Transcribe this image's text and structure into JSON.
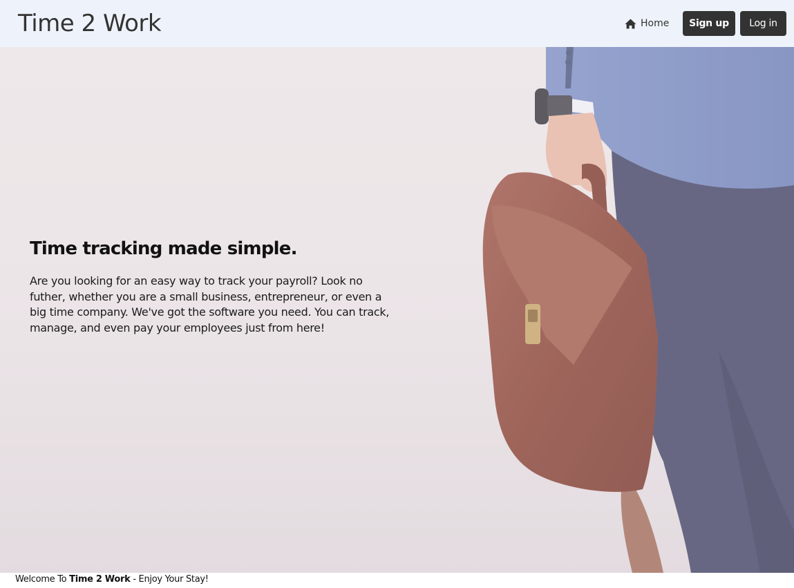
{
  "header": {
    "brand": "Time 2 Work",
    "nav": {
      "home_icon": "home-icon",
      "home_label": "Home",
      "signup_label": "Sign up",
      "login_label": "Log in"
    }
  },
  "hero": {
    "background": "photo of a person in a blue suit jacket carrying a brown leather briefcase",
    "heading": "Time tracking made simple.",
    "body": "Are you looking for an easy way to track your payroll? Look no futher, whether you are a small business, entrepreneur, or even a big time company. We've got the software you need. You can track, manage, and even pay your employees just from here!"
  },
  "footer": {
    "prefix": "Welcome To ",
    "brand": "Time 2 Work",
    "suffix": " - Enjoy Your Stay!"
  },
  "colors": {
    "header_bg": "#eef3fb",
    "button_bg": "#333333",
    "button_text": "#ffffff",
    "jacket": "#8093c6",
    "pants": "#46496a",
    "briefcase": "#8b4a3c"
  }
}
